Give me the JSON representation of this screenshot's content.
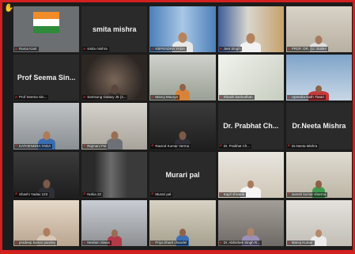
{
  "participants": [
    {
      "id": "p1",
      "label": "Rama Kant",
      "kind": "video",
      "scene": "flag"
    },
    {
      "id": "p2",
      "label": "smita mishra",
      "kind": "name"
    },
    {
      "id": "p3",
      "label": "KBPENDRA YADA",
      "kind": "video",
      "scene": "studio"
    },
    {
      "id": "p4",
      "label": "Jeet Singh",
      "kind": "video",
      "scene": "office"
    },
    {
      "id": "p5",
      "label": "PROF. DR. (Lt. SUBH",
      "kind": "video",
      "scene": "room"
    },
    {
      "id": "p6",
      "label": "Prof Seema Sin...",
      "kind": "name"
    },
    {
      "id": "p7",
      "label": "Samsung Galaxy J5 (2...",
      "kind": "video",
      "scene": "dark",
      "active": true
    },
    {
      "id": "p8",
      "label": "Manoj Maurya",
      "kind": "video",
      "scene": "person_orange"
    },
    {
      "id": "p9",
      "label": "Shashi kashodhan",
      "kind": "video",
      "scene": "book"
    },
    {
      "id": "p10",
      "label": "Upendra Nath Tiwari",
      "kind": "video",
      "scene": "yoga"
    },
    {
      "id": "p11",
      "label": "KATHENDRA YADA",
      "kind": "video",
      "scene": "person_blue"
    },
    {
      "id": "p12",
      "label": "Rajmani Pal",
      "kind": "video",
      "scene": "person_grey"
    },
    {
      "id": "p13",
      "label": "Ravind Kumar Verma",
      "kind": "video",
      "scene": "dark_person"
    },
    {
      "id": "p14",
      "label": "Dr. Prabhat Ch...",
      "kind": "name"
    },
    {
      "id": "p15",
      "label": "Dr.Neeta Mishra",
      "kind": "name"
    },
    {
      "id": "p16",
      "label": "Shashi Yadav 123",
      "kind": "video",
      "scene": "dark_person"
    },
    {
      "id": "p17",
      "label": "Nokia 22",
      "kind": "video",
      "scene": "door"
    },
    {
      "id": "p18",
      "label": "Murari pal",
      "kind": "name"
    },
    {
      "id": "p19",
      "label": "Kapil shivank",
      "kind": "video",
      "scene": "yoga_white"
    },
    {
      "id": "p20",
      "label": "suresh kumar sharma",
      "kind": "video",
      "scene": "person_green"
    },
    {
      "id": "p21",
      "label": "pradeep kumar pandey",
      "kind": "video",
      "scene": "person_light"
    },
    {
      "id": "p22",
      "label": "Neelam Siwan",
      "kind": "video",
      "scene": "person_room"
    },
    {
      "id": "p23",
      "label": "Priya bharti chandel",
      "kind": "video",
      "scene": "person_blue2"
    },
    {
      "id": "p24",
      "label": "Dr. Abhishek Singh R...",
      "kind": "video",
      "scene": "person_grey2"
    },
    {
      "id": "p25",
      "label": "Manoj Kumar",
      "kind": "video",
      "scene": "person_white"
    }
  ],
  "flag_labels": {
    "top": "Rama Kant",
    "bottom": "Rama Kant"
  },
  "colors": {
    "frame": "#d21f1f",
    "active_border": "#d6d84a",
    "mic_muted": "#e53935",
    "raise_hand": "#f2c40f"
  },
  "icons": {
    "raise_hand": "raised-hand-icon",
    "mic": "mic-muted-icon"
  }
}
